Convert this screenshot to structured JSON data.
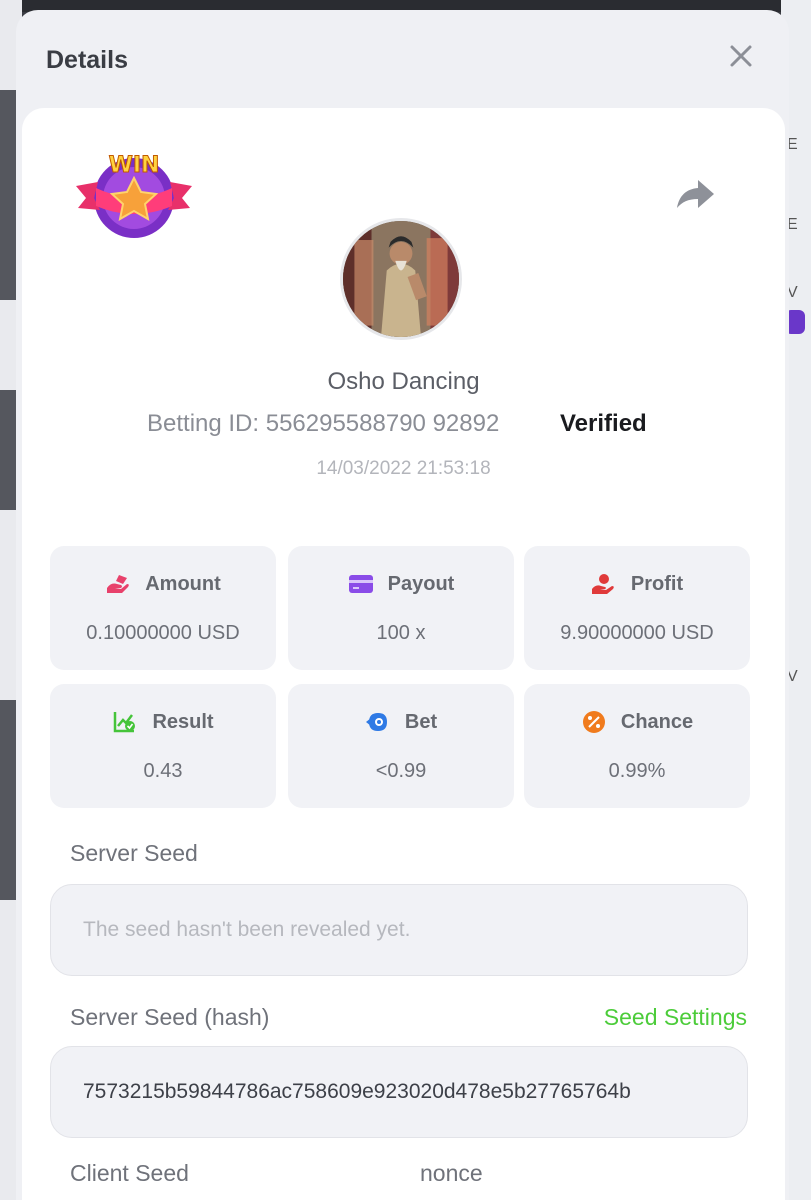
{
  "modal": {
    "title": "Details",
    "close_icon": "close-icon",
    "share_icon": "share-arrow-icon",
    "badge_text": "WIN"
  },
  "game": {
    "name": "Osho Dancing",
    "betting_id": "Betting ID: 556295588790 92892",
    "verified": "Verified",
    "timestamp": "14/03/2022 21:53:18"
  },
  "stats": [
    {
      "label": "Amount",
      "value": "0.10000000 USD",
      "icon": "amount-icon",
      "color": "#e8416b"
    },
    {
      "label": "Payout",
      "value": "100 x",
      "icon": "payout-card-icon",
      "color": "#8a4ce8"
    },
    {
      "label": "Profit",
      "value": "9.90000000 USD",
      "icon": "profit-icon",
      "color": "#e03a3a"
    },
    {
      "label": "Result",
      "value": "0.43",
      "icon": "result-chart-icon",
      "color": "#45c43a"
    },
    {
      "label": "Bet",
      "value": "<0.99",
      "icon": "bet-target-icon",
      "color": "#2f7ae5"
    },
    {
      "label": "Chance",
      "value": "0.99%",
      "icon": "chance-percent-icon",
      "color": "#f07b1d"
    }
  ],
  "server_seed": {
    "label": "Server Seed",
    "placeholder": "The seed hasn't been revealed yet."
  },
  "server_seed_hash": {
    "label": "Server Seed (hash)",
    "link": "Seed Settings",
    "value": "7573215b59844786ac758609e923020d478e5b27765764b"
  },
  "client_seed": {
    "label": "Client Seed"
  },
  "nonce": {
    "label": "nonce"
  },
  "colors": {
    "accent_green": "#4ccc3a",
    "card_bg": "#f1f2f6",
    "modal_bg": "#eff0f4"
  }
}
